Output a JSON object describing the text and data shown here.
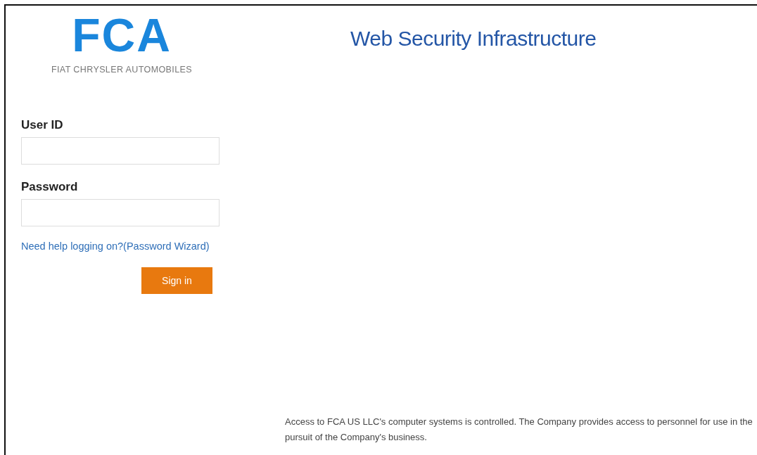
{
  "logo": {
    "mark": "FCA",
    "tagline": "FIAT CHRYSLER AUTOMOBILES"
  },
  "title": "Web Security Infrastructure",
  "form": {
    "fields": [
      {
        "label": "User ID"
      },
      {
        "label": "Password"
      }
    ],
    "help_link": "Need help logging on?(Password Wizard)",
    "submit": "Sign in"
  },
  "disclaimer": "Access to FCA US LLC's computer systems is controlled. The Company provides access to personnel for use in the pursuit of the Company's business."
}
